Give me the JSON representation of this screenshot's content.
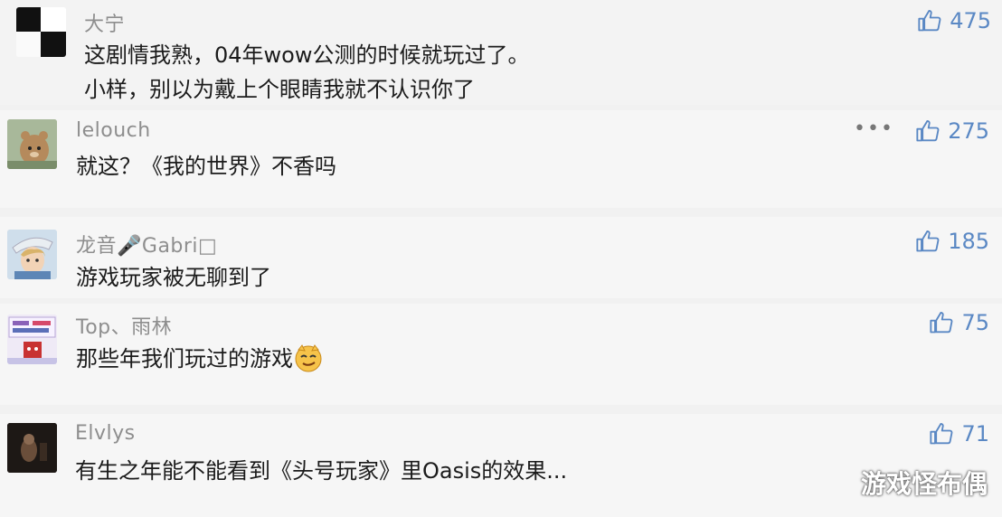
{
  "comments": [
    {
      "username": "大宁",
      "lines": [
        "这剧情我熟，04年wow公测的时候就玩过了。",
        "小样，别以为戴上个眼睛我就不认识你了"
      ],
      "likes": "475",
      "avatar": "checkerboard-avatar"
    },
    {
      "username": "lelouch",
      "lines": [
        "就这？《我的世界》不香吗"
      ],
      "likes": "275",
      "more": "•••",
      "avatar": "bear-avatar"
    },
    {
      "username": "龙音🎤Gabri□",
      "lines": [
        "游戏玩家被无聊到了"
      ],
      "likes": "185",
      "avatar": "anime-character-avatar"
    },
    {
      "username": "Top、雨林",
      "lines": [
        "那些年我们玩过的游戏"
      ],
      "emoji": "smirk-face-emoji",
      "likes": "75",
      "avatar": "cartoon-avatar"
    },
    {
      "username": "Elvlys",
      "lines": [
        "有生之年能不能看到《头号玩家》里Oasis的效果..."
      ],
      "likes": "71",
      "avatar": "dark-photo-avatar"
    }
  ],
  "watermark": "游戏怪布偶",
  "colors": {
    "like_blue": "#5a88c4",
    "username_gray": "#8e8e8e",
    "text_dark": "#1b1b1b"
  }
}
